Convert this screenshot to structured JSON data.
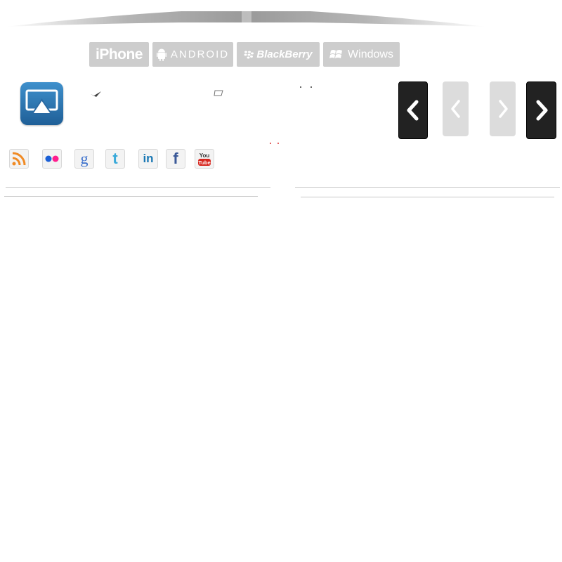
{
  "platform_tabs": {
    "iphone": "iPhone",
    "android": "ANDROID",
    "blackberry": "BlackBerry",
    "windows": "Windows"
  },
  "app": {
    "icon": "airplay-icon"
  },
  "navigation": {
    "prev_icon": "chevron-left-icon",
    "next_icon": "chevron-right-icon"
  },
  "social": [
    "rss-icon",
    "flickr-icon",
    "google-icon",
    "twitter-icon",
    "linkedin-icon",
    "facebook-icon",
    "youtube-icon"
  ],
  "colors": {
    "tab_bg": "#cdcdcd",
    "airplay_blue": "#2b75b3",
    "arrow_dark": "#222222",
    "arrow_light": "#dcdcdc"
  }
}
